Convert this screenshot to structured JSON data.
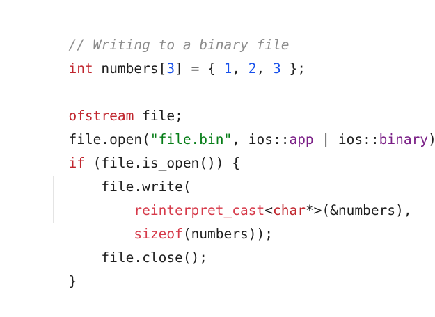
{
  "code": {
    "lines": [
      [
        {
          "t": "// Writing to a binary file",
          "k": "comment"
        }
      ],
      [
        {
          "t": "int",
          "k": "keyword"
        },
        {
          "t": " numbers[",
          "k": "punct"
        },
        {
          "t": "3",
          "k": "number"
        },
        {
          "t": "] = { ",
          "k": "punct"
        },
        {
          "t": "1",
          "k": "number"
        },
        {
          "t": ", ",
          "k": "punct"
        },
        {
          "t": "2",
          "k": "number"
        },
        {
          "t": ", ",
          "k": "punct"
        },
        {
          "t": "3",
          "k": "number"
        },
        {
          "t": " };",
          "k": "punct"
        }
      ],
      [],
      [
        {
          "t": "ofstream",
          "k": "keyword"
        },
        {
          "t": " file;",
          "k": "punct"
        }
      ],
      [
        {
          "t": "file.open(",
          "k": "punct"
        },
        {
          "t": "\"file.bin\"",
          "k": "string"
        },
        {
          "t": ", ios::",
          "k": "punct"
        },
        {
          "t": "app",
          "k": "member"
        },
        {
          "t": " | ios::",
          "k": "punct"
        },
        {
          "t": "binary",
          "k": "member"
        },
        {
          "t": ");",
          "k": "punct"
        }
      ],
      [
        {
          "t": "if",
          "k": "keyword"
        },
        {
          "t": " (file.is_open()) {",
          "k": "punct"
        }
      ],
      [
        {
          "t": "    file.write(",
          "k": "punct"
        }
      ],
      [
        {
          "t": "        ",
          "k": "punct"
        },
        {
          "t": "reinterpret_cast",
          "k": "func"
        },
        {
          "t": "<",
          "k": "punct"
        },
        {
          "t": "char",
          "k": "keyword"
        },
        {
          "t": "*>(&numbers),",
          "k": "punct"
        }
      ],
      [
        {
          "t": "        ",
          "k": "punct"
        },
        {
          "t": "sizeof",
          "k": "func"
        },
        {
          "t": "(numbers));",
          "k": "punct"
        }
      ],
      [
        {
          "t": "    file.close();",
          "k": "punct"
        }
      ],
      [
        {
          "t": "}",
          "k": "punct"
        }
      ]
    ]
  },
  "colors": {
    "background": "#ffffff",
    "comment": "#8c8c8c",
    "keyword": "#c0262e",
    "number": "#1750eb",
    "string": "#067d17",
    "member": "#7a1f86",
    "function": "#d63a4a",
    "text": "#1f1f1f",
    "indent_guide": "#e4e4e4"
  }
}
